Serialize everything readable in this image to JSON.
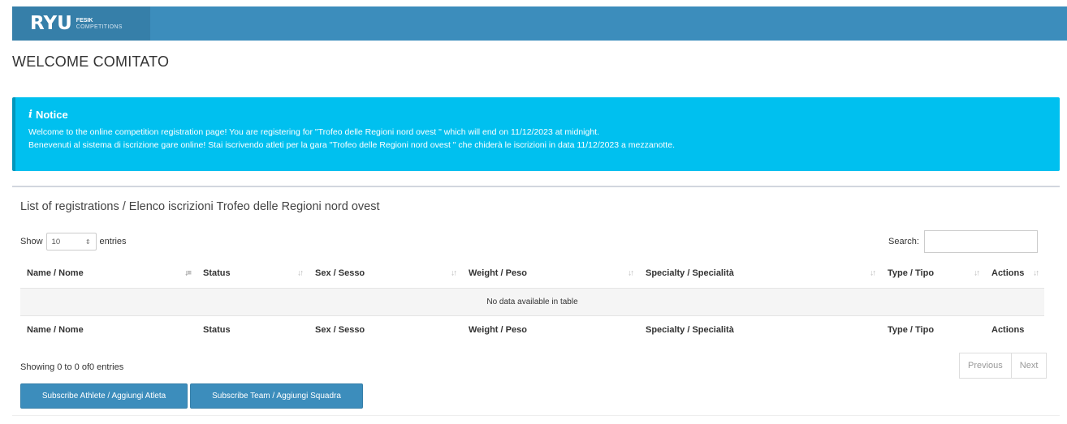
{
  "header": {
    "logo_main": "RYU",
    "logo_sub_1": "FESIK",
    "logo_sub_2": "COMPETITIONS"
  },
  "welcome": "WELCOME COMITATO",
  "notice": {
    "title": "Notice",
    "line_en": "Welcome to the online competition registration page! You are registering for \"Trofeo delle Regioni nord ovest \" which will end on 11/12/2023 at midnight.",
    "line_it": "Benevenuti al sistema di iscrizione gare online! Stai iscrivendo atleti per la gara \"Trofeo delle Regioni nord ovest \" che chiderà le iscrizioni in data 11/12/2023 a mezzanotte.",
    "color": "#00c0ef"
  },
  "registrations": {
    "title": "List of registrations / Elenco iscrizioni Trofeo delle Regioni nord ovest",
    "show_label": "Show",
    "page_length": "10",
    "entries_label": "entries",
    "search_label": "Search:",
    "columns": [
      "Name / Nome",
      "Status",
      "Sex / Sesso",
      "Weight / Peso",
      "Specialty / Specialità",
      "Type / Tipo",
      "Actions"
    ],
    "empty_message": "No data available in table",
    "info": "Showing 0 to 0 of0 entries",
    "previous_label": "Previous",
    "next_label": "Next"
  },
  "actions": {
    "subscribe_athlete": "Subscribe Athlete / Aggiungi Atleta",
    "subscribe_team": "Subscribe Team / Aggiungi Squadra"
  },
  "colors": {
    "primary": "#3c8dbc",
    "primary_dark": "#367fa9",
    "info": "#00c0ef"
  }
}
